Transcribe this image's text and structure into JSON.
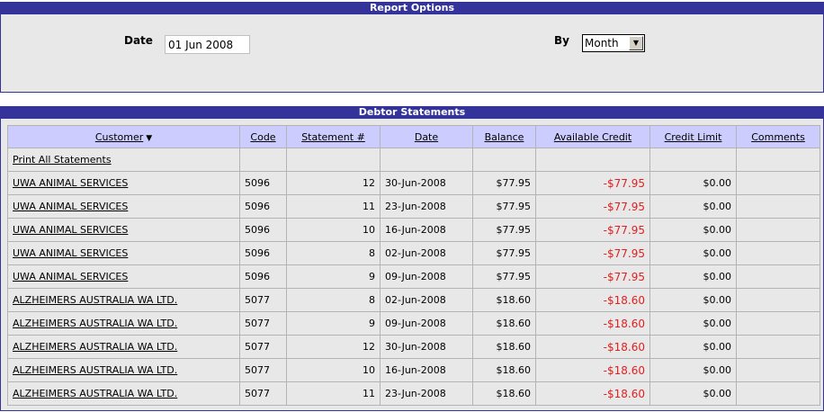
{
  "report_options": {
    "title": "Report Options",
    "date_label": "Date",
    "date_value": "01 Jun 2008",
    "by_label": "By",
    "by_value": "Month"
  },
  "debtor_statements": {
    "title": "Debtor Statements",
    "columns": {
      "customer": "Customer",
      "code": "Code",
      "statement": "Statement #",
      "date": "Date",
      "balance": "Balance",
      "available_credit": "Available Credit",
      "credit_limit": "Credit Limit",
      "comments": "Comments"
    },
    "print_all": "Print All Statements",
    "rows": [
      {
        "customer": "UWA ANIMAL SERVICES",
        "code": "5096",
        "statement": "12",
        "date": "30-Jun-2008",
        "balance": "$77.95",
        "available_credit": "-$77.95",
        "credit_limit": "$0.00",
        "comments": ""
      },
      {
        "customer": "UWA ANIMAL SERVICES",
        "code": "5096",
        "statement": "11",
        "date": "23-Jun-2008",
        "balance": "$77.95",
        "available_credit": "-$77.95",
        "credit_limit": "$0.00",
        "comments": ""
      },
      {
        "customer": "UWA ANIMAL SERVICES",
        "code": "5096",
        "statement": "10",
        "date": "16-Jun-2008",
        "balance": "$77.95",
        "available_credit": "-$77.95",
        "credit_limit": "$0.00",
        "comments": ""
      },
      {
        "customer": "UWA ANIMAL SERVICES",
        "code": "5096",
        "statement": "8",
        "date": "02-Jun-2008",
        "balance": "$77.95",
        "available_credit": "-$77.95",
        "credit_limit": "$0.00",
        "comments": ""
      },
      {
        "customer": "UWA ANIMAL SERVICES",
        "code": "5096",
        "statement": "9",
        "date": "09-Jun-2008",
        "balance": "$77.95",
        "available_credit": "-$77.95",
        "credit_limit": "$0.00",
        "comments": ""
      },
      {
        "customer": "ALZHEIMERS AUSTRALIA WA LTD.",
        "code": "5077",
        "statement": "8",
        "date": "02-Jun-2008",
        "balance": "$18.60",
        "available_credit": "-$18.60",
        "credit_limit": "$0.00",
        "comments": ""
      },
      {
        "customer": "ALZHEIMERS AUSTRALIA WA LTD.",
        "code": "5077",
        "statement": "9",
        "date": "09-Jun-2008",
        "balance": "$18.60",
        "available_credit": "-$18.60",
        "credit_limit": "$0.00",
        "comments": ""
      },
      {
        "customer": "ALZHEIMERS AUSTRALIA WA LTD.",
        "code": "5077",
        "statement": "12",
        "date": "30-Jun-2008",
        "balance": "$18.60",
        "available_credit": "-$18.60",
        "credit_limit": "$0.00",
        "comments": ""
      },
      {
        "customer": "ALZHEIMERS AUSTRALIA WA LTD.",
        "code": "5077",
        "statement": "10",
        "date": "16-Jun-2008",
        "balance": "$18.60",
        "available_credit": "-$18.60",
        "credit_limit": "$0.00",
        "comments": ""
      },
      {
        "customer": "ALZHEIMERS AUSTRALIA WA LTD.",
        "code": "5077",
        "statement": "11",
        "date": "23-Jun-2008",
        "balance": "$18.60",
        "available_credit": "-$18.60",
        "credit_limit": "$0.00",
        "comments": ""
      }
    ],
    "colors": {
      "header_bar": "#333399",
      "column_header": "#ccccff",
      "negative": "#e02020",
      "panel_bg": "#e8e8e8"
    }
  }
}
